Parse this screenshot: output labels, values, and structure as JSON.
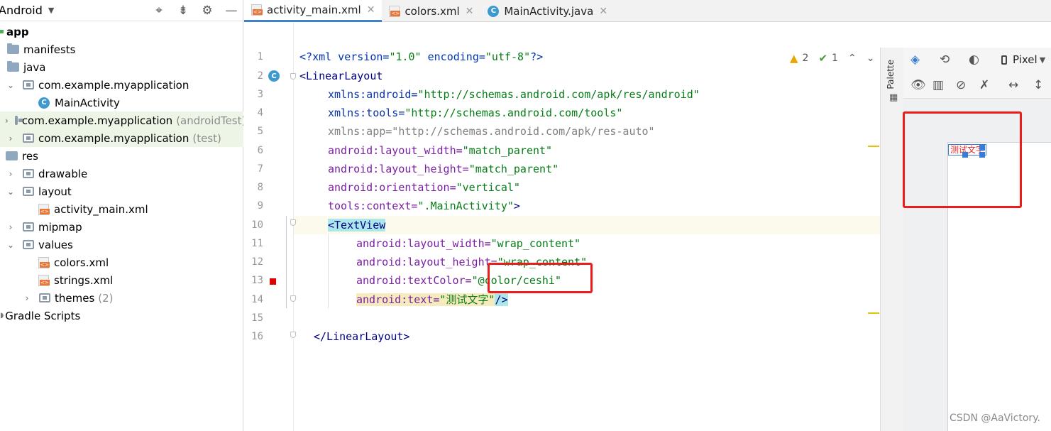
{
  "project_panel": {
    "view_selector": "Android",
    "tree": [
      {
        "label": "app",
        "type": "module",
        "bold": true
      },
      {
        "label": "manifests",
        "type": "folder"
      },
      {
        "label": "java",
        "type": "folder"
      },
      {
        "label": "com.example.myapplication",
        "type": "package",
        "expanded": true
      },
      {
        "label": "MainActivity",
        "type": "class"
      },
      {
        "label": "com.example.myapplication",
        "suffix": "(androidTest)",
        "type": "package"
      },
      {
        "label": "com.example.myapplication",
        "suffix": "(test)",
        "type": "package"
      },
      {
        "label": "res",
        "type": "folder"
      },
      {
        "label": "drawable",
        "type": "package"
      },
      {
        "label": "layout",
        "type": "package",
        "expanded": true
      },
      {
        "label": "activity_main.xml",
        "type": "xml"
      },
      {
        "label": "mipmap",
        "type": "package"
      },
      {
        "label": "values",
        "type": "package",
        "expanded": true
      },
      {
        "label": "colors.xml",
        "type": "xml"
      },
      {
        "label": "strings.xml",
        "type": "xml"
      },
      {
        "label": "themes",
        "suffix": "(2)",
        "type": "package"
      },
      {
        "label": "Gradle Scripts",
        "type": "gradle"
      }
    ]
  },
  "tabs": [
    {
      "label": "activity_main.xml",
      "active": true,
      "icon": "xml-file-icon"
    },
    {
      "label": "colors.xml",
      "active": false,
      "icon": "xml-file-icon"
    },
    {
      "label": "MainActivity.java",
      "active": false,
      "icon": "class-icon"
    }
  ],
  "editor": {
    "line_numbers": [
      "1",
      "2",
      "3",
      "4",
      "5",
      "6",
      "7",
      "8",
      "9",
      "10",
      "11",
      "12",
      "13",
      "14",
      "15",
      "16"
    ],
    "inspections": {
      "warnings": "2",
      "weak_warnings": "1"
    },
    "lines": {
      "l1": {
        "a": "<?",
        "b": "xml version=",
        "c": "\"1.0\"",
        "d": " encoding=",
        "e": "\"utf-8\"",
        "f": "?>"
      },
      "l2": {
        "a": "<LinearLayout"
      },
      "l3": {
        "a": "xmlns:android=",
        "b": "\"http://schemas.android.com/apk/res/android\""
      },
      "l4": {
        "a": "xmlns:tools=",
        "b": "\"http://schemas.android.com/tools\""
      },
      "l5": {
        "a": "xmlns:app=\"http://schemas.android.com/apk/res-auto\""
      },
      "l6": {
        "a": "android:layout_width=",
        "b": "\"match_parent\""
      },
      "l7": {
        "a": "android:layout_height=",
        "b": "\"match_parent\""
      },
      "l8": {
        "a": "android:orientation=",
        "b": "\"vertical\""
      },
      "l9": {
        "a": "tools:context=",
        "b": "\".MainActivity\"",
        "c": ">"
      },
      "l10": {
        "a": "<TextView"
      },
      "l11": {
        "a": "android:layout_width=",
        "b": "\"wrap_content\""
      },
      "l12": {
        "a": "android:layout_height=",
        "b": "\"wrap_content\""
      },
      "l13": {
        "a": "android:textColor=",
        "b": "\"@color/ceshi\""
      },
      "l14": {
        "a": "android:text=",
        "b": "\"测试文字\"",
        "c": "/>"
      },
      "l16": {
        "a": "</LinearLayout>"
      }
    }
  },
  "design_panel": {
    "palette_label": "Palette",
    "device": "Pixel",
    "preview_text": "测试文字",
    "preview_text_color": "#e02828"
  },
  "watermark": "CSDN @AaVictory.",
  "colors": {
    "accent": "#4083c9",
    "highlight_box": "#ea1c1c"
  }
}
